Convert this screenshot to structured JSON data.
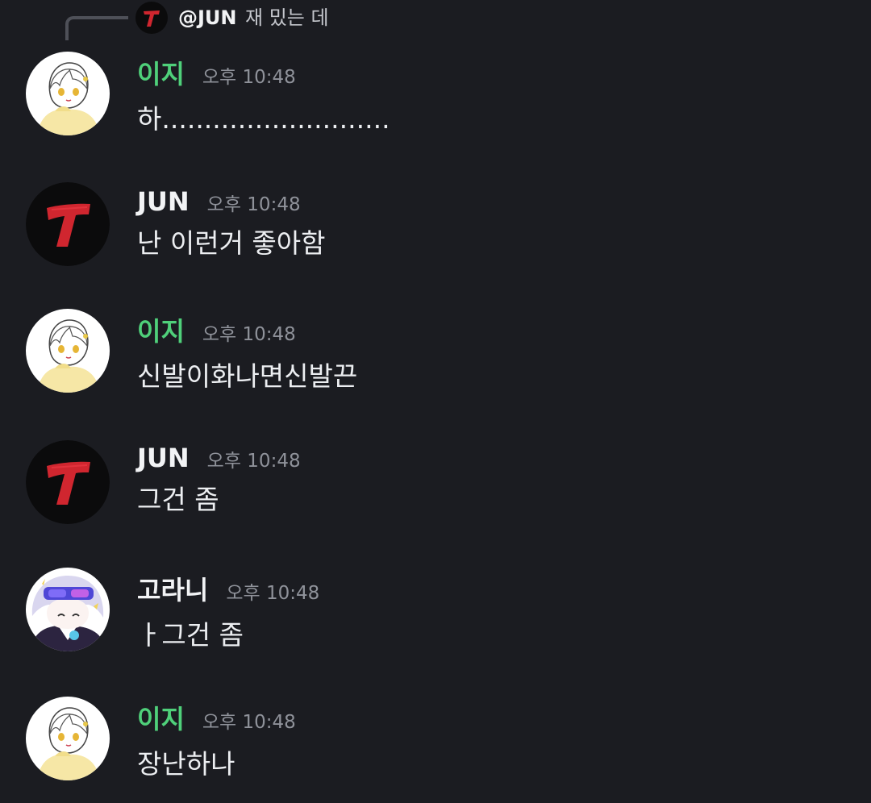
{
  "reply": {
    "author": "@JUN",
    "text": "재 밌는 데"
  },
  "messages": [
    {
      "author": "이지",
      "author_color": "#4fd07a",
      "avatar": "anime-girl-yellow-hoodie",
      "time": "오후 10:48",
      "text": "하..........................."
    },
    {
      "author": "JUN",
      "author_color": "#f2f3f5",
      "avatar": "red-t-logo",
      "time": "오후 10:48",
      "text": "난 이런거 좋아함"
    },
    {
      "author": "이지",
      "author_color": "#4fd07a",
      "avatar": "anime-girl-yellow-hoodie",
      "time": "오후 10:48",
      "text": "신발이화나면신발끈"
    },
    {
      "author": "JUN",
      "author_color": "#f2f3f5",
      "avatar": "red-t-logo",
      "time": "오후 10:48",
      "text": "그건 좀"
    },
    {
      "author": "고라니",
      "author_color": "#f2f3f5",
      "avatar": "anime-character-sunglasses",
      "time": "오후 10:48",
      "text": "ㅏ그건 좀"
    },
    {
      "author": "이지",
      "author_color": "#4fd07a",
      "avatar": "anime-girl-yellow-hoodie",
      "time": "오후 10:48",
      "text": "장난하나"
    }
  ]
}
